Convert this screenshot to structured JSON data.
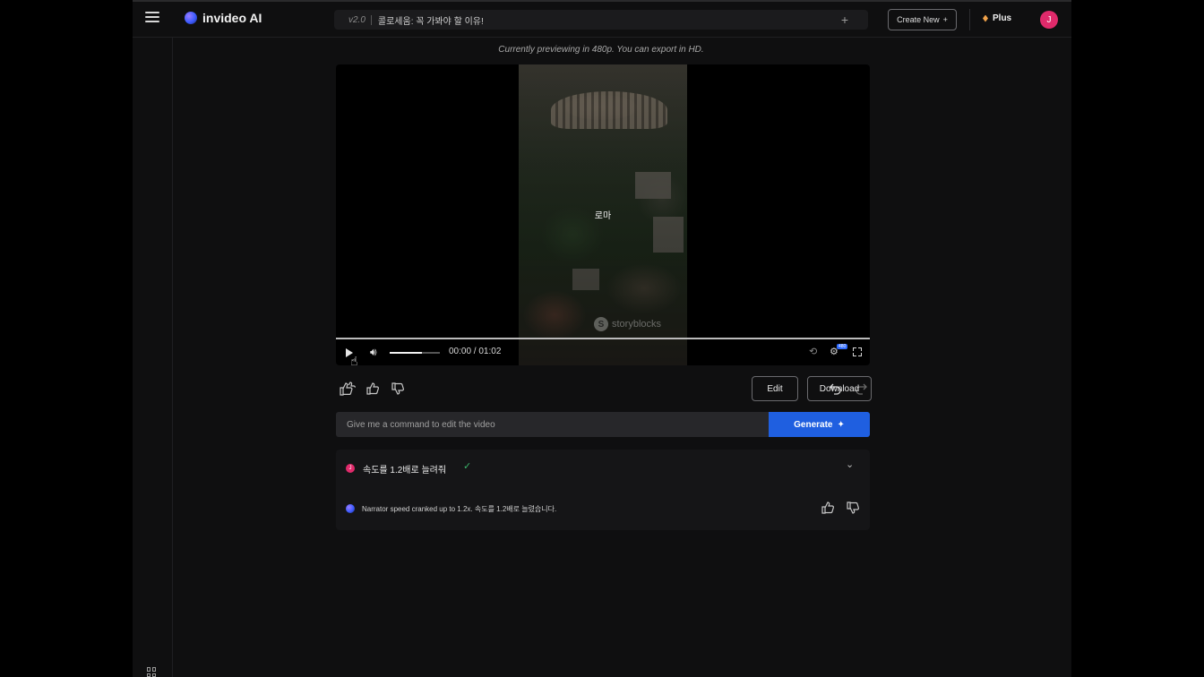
{
  "header": {
    "brand": "invideo AI",
    "version": "v2.0",
    "project_title": "콜로세움: 꼭 가봐야 할 이유!",
    "create_new_label": "Create New",
    "plan_label": "Plus",
    "avatar_initial": "J"
  },
  "preview": {
    "note": "Currently previewing in 480p. You can export in HD.",
    "caption": "로마",
    "watermark": "storyblocks",
    "watermark_glyph": "S",
    "time": "00:00 / 01:02",
    "quality": "480",
    "volume_level": 0.65,
    "progress": 0
  },
  "actions": {
    "edit_label": "Edit",
    "download_label": "Download"
  },
  "command": {
    "placeholder": "Give me a command to edit the video",
    "generate_label": "Generate"
  },
  "history": {
    "user_initial": "J",
    "user_command": "속도를 1.2배로 늘려줘",
    "ai_reply": "Narrator speed cranked up to 1.2x. 속도를 1.2배로 늘렸습니다."
  },
  "colors": {
    "accent_blue": "#1f5fe0",
    "avatar_pink": "#e02a6b",
    "success_green": "#3bb36a",
    "plan_gold": "#f0a24a"
  }
}
